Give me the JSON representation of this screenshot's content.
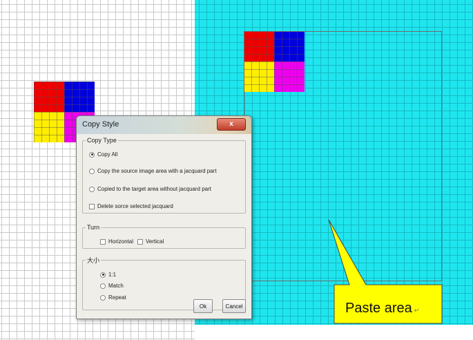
{
  "canvas": {
    "source_grid_color": "#ffffff",
    "target_grid_color": "#1fe6ee",
    "block_colors": {
      "top_left": "#ee0000",
      "top_right": "#0000dd",
      "bottom_left": "#ffee00",
      "bottom_right": "#ee00ee"
    }
  },
  "dialog": {
    "title": "Copy Style",
    "close_label": "x",
    "copy_type": {
      "legend": "Copy Type",
      "options": [
        {
          "label": "Copy All",
          "selected": true
        },
        {
          "label": "Copy the source image area with a jacquard part",
          "selected": false
        },
        {
          "label": "Copied to the target area without jacquard part",
          "selected": false
        }
      ],
      "delete_checkbox": {
        "label": "Delete sorce selected jacquard",
        "checked": false
      }
    },
    "turn": {
      "legend": "Turn",
      "horizontal": {
        "label": "Horizontal",
        "checked": false
      },
      "vertical": {
        "label": "Vertical",
        "checked": false
      }
    },
    "size": {
      "legend": "大小",
      "options": [
        {
          "label": "1:1",
          "selected": true
        },
        {
          "label": "Match",
          "selected": false
        },
        {
          "label": "Repeat",
          "selected": false
        }
      ]
    },
    "ok_label": "Ok",
    "cancel_label": "Cancel"
  },
  "callout": {
    "text": "Paste area",
    "return_glyph": "↵",
    "fill_color": "#ffff00"
  }
}
